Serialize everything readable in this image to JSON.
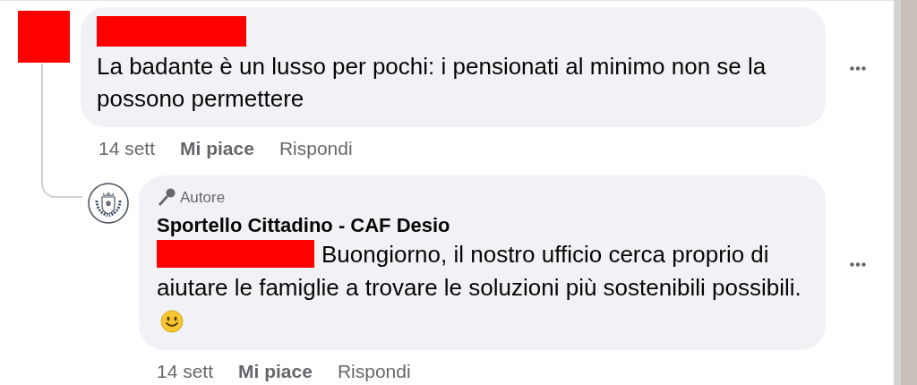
{
  "comments": [
    {
      "author_redacted": true,
      "text": "La badante è un lusso per pochi: i pensionati al minimo non se la possono permettere",
      "time": "14 sett",
      "like": "Mi piace",
      "reply": "Rispondi",
      "replies": [
        {
          "badge": "Autore",
          "author": "Sportello Cittadino - CAF Desio",
          "mention_redacted": true,
          "text": "Buongiorno, il nostro ufficio cerca proprio di aiutare le famiglie a trovare le soluzioni più sostenibili possibili.",
          "emoji": true,
          "time": "14 sett",
          "like": "Mi piace",
          "reply": "Rispondi"
        }
      ]
    }
  ]
}
